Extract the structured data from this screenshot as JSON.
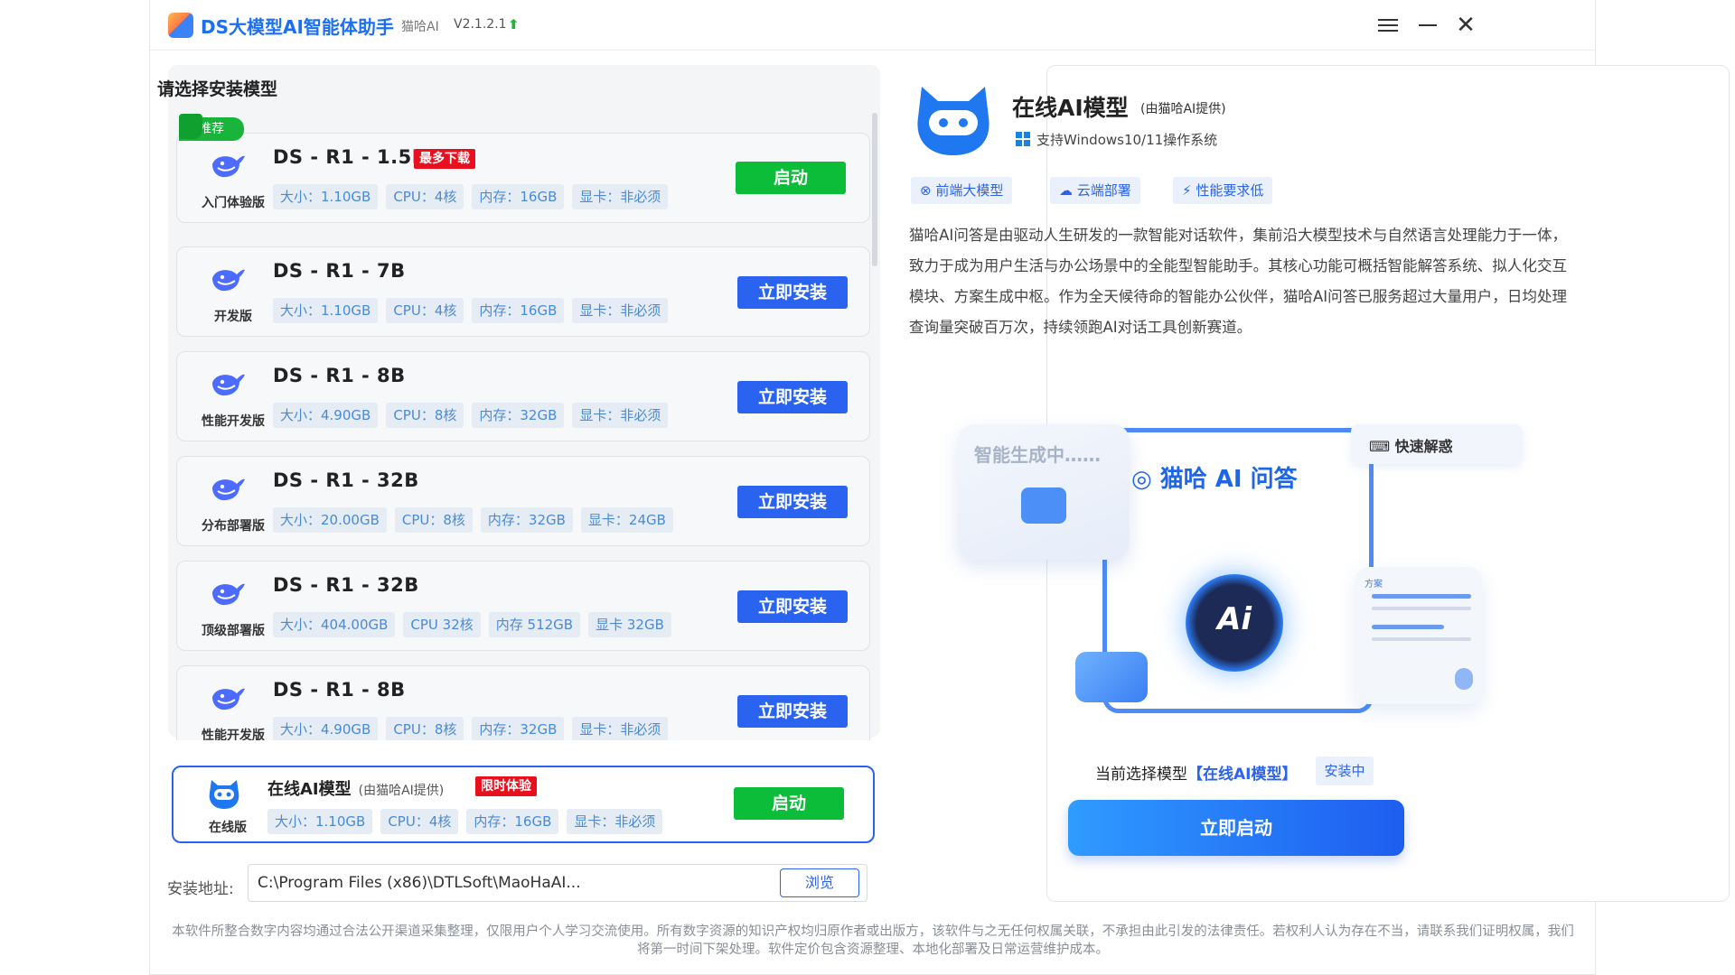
{
  "app": {
    "title": "DS大模型AI智能体助手",
    "sub": "猫哈AI",
    "version": "V2.1.2.1"
  },
  "left": {
    "title": "请选择安装模型",
    "recommend_badge": "推荐",
    "cards": [
      {
        "name": "DS - R1 - 1.5B",
        "tag": "最多下载",
        "edition": "入门体验版",
        "chips": [
          "大小：1.10GB",
          "CPU：4核",
          "内存：16GB",
          "显卡：非必须"
        ],
        "button": "启动",
        "button_type": "green"
      },
      {
        "name": "DS - R1 - 7B",
        "tag": "",
        "edition": "开发版",
        "chips": [
          "大小：1.10GB",
          "CPU：4核",
          "内存：16GB",
          "显卡：非必须"
        ],
        "button": "立即安装",
        "button_type": "blue"
      },
      {
        "name": "DS - R1 - 8B",
        "tag": "",
        "edition": "性能开发版",
        "chips": [
          "大小：4.90GB",
          "CPU：8核",
          "内存：32GB",
          "显卡：非必须"
        ],
        "button": "立即安装",
        "button_type": "blue"
      },
      {
        "name": "DS - R1 - 32B",
        "tag": "",
        "edition": "分布部署版",
        "chips": [
          "大小：20.00GB",
          "CPU：8核",
          "内存：32GB",
          "显卡：24GB"
        ],
        "button": "立即安装",
        "button_type": "blue"
      },
      {
        "name": "DS - R1 - 32B",
        "tag": "",
        "edition": "顶级部署版",
        "chips": [
          "大小：404.00GB",
          "CPU 32核",
          "内存 512GB",
          "显卡 32GB"
        ],
        "button": "立即安装",
        "button_type": "blue"
      },
      {
        "name": "DS - R1 - 8B",
        "tag": "",
        "edition": "性能开发版",
        "chips": [
          "大小：4.90GB",
          "CPU：8核",
          "内存：32GB",
          "显卡：非必须"
        ],
        "button": "立即安装",
        "button_type": "blue"
      }
    ],
    "online": {
      "name": "在线AI模型",
      "provider": "(由猫哈AI提供)",
      "tag": "限时体验",
      "edition": "在线版",
      "chips": [
        "大小：1.10GB",
        "CPU：4核",
        "内存：16GB",
        "显卡：非必须"
      ],
      "button": "启动"
    },
    "install_path": {
      "label": "安装地址:",
      "value": "C:\\Program Files (x86)\\DTLSoft\\MaoHaAI...",
      "browse": "浏览"
    }
  },
  "right": {
    "title": "在线AI模型",
    "provider": "(由猫哈AI提供)",
    "os": "支持Windows10/11操作系统",
    "features": [
      "前端大模型",
      "云端部署",
      "性能要求低"
    ],
    "description": "猫哈AI问答是由驱动人生研发的一款智能对话软件，集前沿大模型技术与自然语言处理能力于一体，致力于成为用户生活与办公场景中的全能型智能助手。其核心功能可概括智能解答系统、拟人化交互模块、方案生成中枢。作为全天候待命的智能办公伙伴，猫哈AI问答已服务超过大量用户，日均处理查询量突破百万次，持续领跑AI对话工具创新赛道。",
    "illustration": {
      "generating": "智能生成中……",
      "quick": "快速解惑",
      "brand": "猫哈 AI 问答",
      "ai": "Ai",
      "plan": "方案"
    },
    "current_label": "当前选择模型",
    "current_model": "【在线AI模型】",
    "status": "安装中",
    "start_button": "立即启动"
  },
  "footer": "本软件所整合数字内容均通过合法公开渠道采集整理，仅限用户个人学习交流使用。所有数字资源的知识产权均归原作者或出版方，该软件与之无任何权属关联，不承担由此引发的法律责任。若权利人认为存在不当，请联系我们证明权属，我们将第一时间下架处理。软件定价包含资源整理、本地化部署及日常运营维护成本。",
  "colors": {
    "primary": "#2a63f0",
    "green": "#0bbd38",
    "red_tag": "#e8101e"
  }
}
